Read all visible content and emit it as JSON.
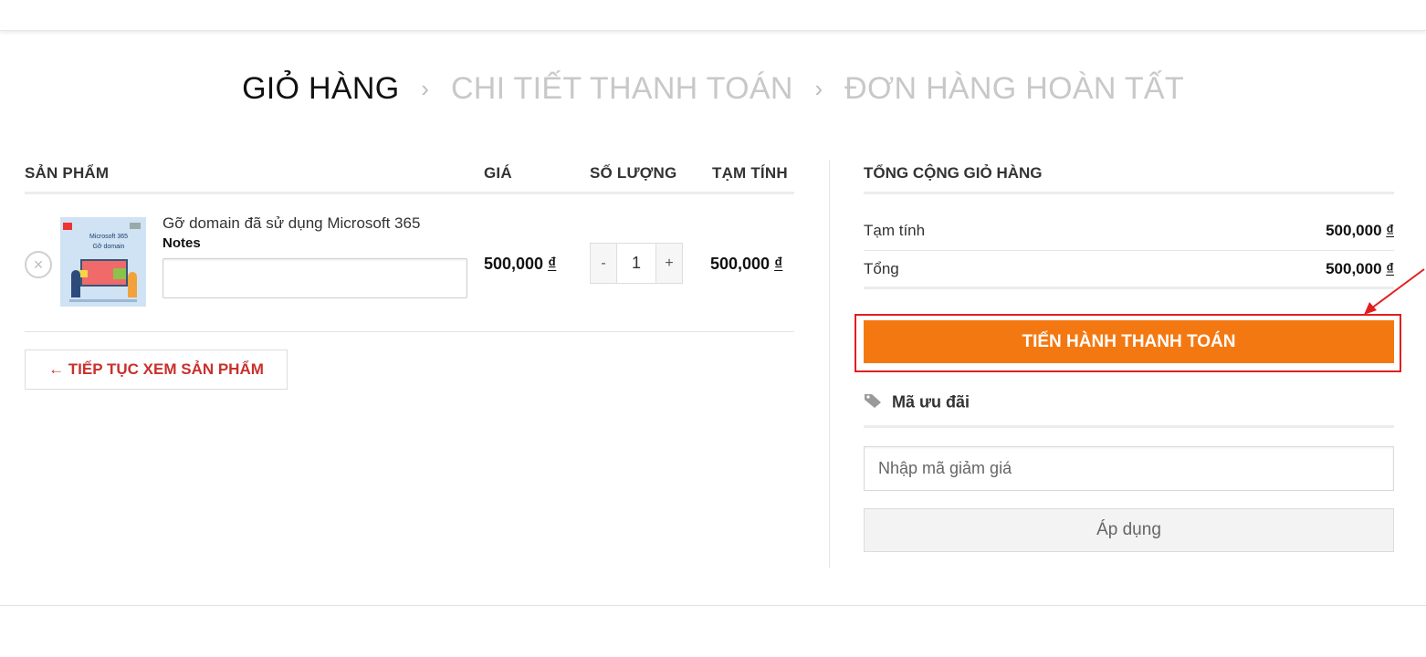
{
  "breadcrumb": {
    "step1": "GIỎ HÀNG",
    "sep": "›",
    "step2": "CHI TIẾT THANH TOÁN",
    "step3": "ĐƠN HÀNG HOÀN TẤT"
  },
  "cart_table": {
    "headers": {
      "product": "SẢN PHẨM",
      "price": "GIÁ",
      "quantity": "SỐ LƯỢNG",
      "subtotal": "TẠM TÍNH"
    },
    "items": [
      {
        "name": "Gỡ domain đã sử dụng Microsoft 365",
        "notes_label": "Notes",
        "notes_value": "",
        "thumb_title": "Microsoft 365",
        "thumb_subtitle": "Gỡ domain",
        "price": "500,000",
        "currency": "₫",
        "quantity": "1",
        "qty_minus": "-",
        "qty_plus": "+",
        "subtotal": "500,000",
        "remove_icon": "×"
      }
    ],
    "continue_button": "← TIẾP TỤC XEM SẢN PHẨM"
  },
  "cart_totals": {
    "title": "TỔNG CỘNG GIỎ HÀNG",
    "rows": [
      {
        "label": "Tạm tính",
        "value": "500,000",
        "currency": "₫"
      },
      {
        "label": "Tổng",
        "value": "500,000",
        "currency": "₫"
      }
    ],
    "checkout_button": "TIẾN HÀNH THANH TOÁN",
    "coupon_title": "Mã ưu đãi",
    "coupon_placeholder": "Nhập mã giảm giá",
    "apply_button": "Áp dụng"
  },
  "colors": {
    "checkout_bg": "#f47811",
    "highlight": "#e31e1e",
    "continue_text": "#c9302c"
  },
  "icons": {
    "remove": "close-circle-icon",
    "coupon": "tag-icon",
    "annotation": "red-arrow-icon"
  }
}
